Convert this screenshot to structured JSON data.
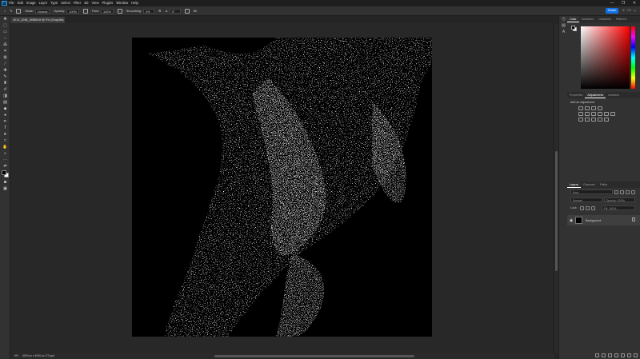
{
  "app": {
    "logo": "Ps"
  },
  "menu": [
    "File",
    "Edit",
    "Image",
    "Layer",
    "Type",
    "Select",
    "Filter",
    "3D",
    "View",
    "Plugins",
    "Window",
    "Help"
  ],
  "window_controls": [
    "—",
    "❐",
    "✕"
  ],
  "options": {
    "mode_label": "Mode:",
    "mode_value": "Normal",
    "opacity_label": "Opacity:",
    "opacity_value": "100%",
    "flow_label": "Flow:",
    "flow_value": "100%",
    "smoothing_label": "Smoothing:",
    "smoothing_value": "0%",
    "angle_value": "0°",
    "share_label": "Share"
  },
  "document": {
    "tab_title": "2012_DNB_DBBB.tif @ 9% (Gray/8#)",
    "close": "×"
  },
  "status": {
    "zoom": "9%",
    "size": "4000 px x 4000 px (72 ppi)"
  },
  "panels": {
    "color_tabs": [
      "Color",
      "Swatches",
      "Gradients",
      "Patterns"
    ],
    "adjust_tabs": [
      "Properties",
      "Adjustments",
      "Libraries"
    ],
    "adjust_title": "Add an adjustment",
    "layer_tabs": [
      "Layers",
      "Channels",
      "Paths"
    ],
    "layer_search": "Kind",
    "layer_blend": "Normal",
    "layer_opacity": "Opacity: 100%",
    "lock_label": "Lock:",
    "fill_label": "Fill: 100%",
    "layer_name": "Background"
  },
  "colors": {
    "accent": "#1473e6",
    "bg": "#252525",
    "panel": "#323232",
    "fg_color": "#000000",
    "bg_color": "#ffffff"
  }
}
